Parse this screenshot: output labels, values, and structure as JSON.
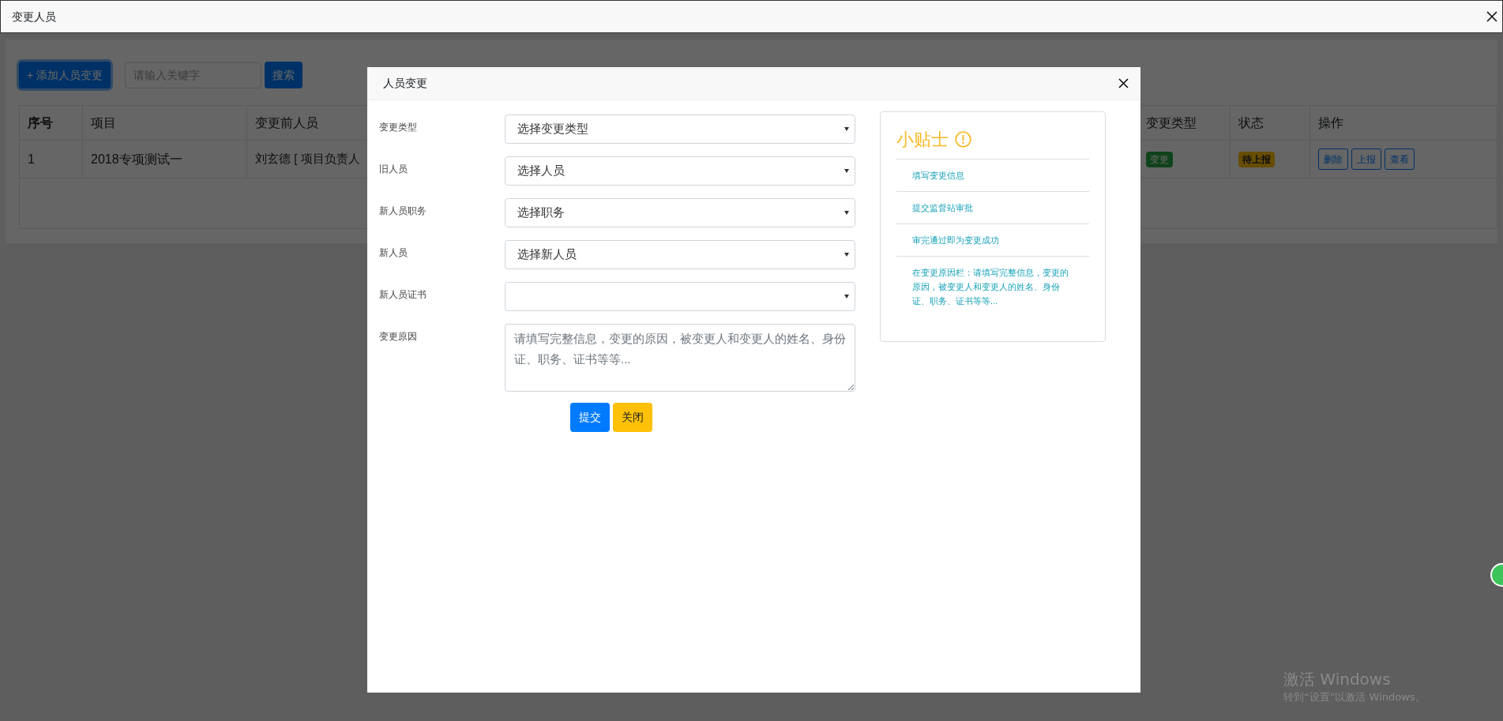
{
  "window": {
    "title": "变更人员"
  },
  "toolbar": {
    "add_button": "+ 添加人员变更",
    "search": {
      "placeholder": "请输入关键字"
    },
    "search_button": "搜索"
  },
  "table": {
    "columns": [
      "序号",
      "项目",
      "变更前人员",
      "变更类型",
      "状态",
      "操作"
    ],
    "rows": [
      {
        "index": "1",
        "project": "2018专项测试一",
        "before_person": "刘玄德 [ 项目负责人",
        "change_type": {
          "text": "变更",
          "kind": "success"
        },
        "status": {
          "text": "待上报",
          "kind": "warning"
        },
        "actions": [
          "删除",
          "上报",
          "查看"
        ]
      }
    ]
  },
  "modal": {
    "title": "人员变更",
    "fields": [
      {
        "label": "变更类型",
        "kind": "select",
        "value": "选择变更类型"
      },
      {
        "label": "旧人员",
        "kind": "select",
        "value": "选择人员"
      },
      {
        "label": "新人员职务",
        "kind": "select",
        "value": "选择职务"
      },
      {
        "label": "新人员",
        "kind": "select",
        "value": "选择新人员"
      },
      {
        "label": "新人员证书",
        "kind": "select"
      },
      {
        "label": "变更原因",
        "kind": "textarea",
        "placeholder": "请填写完整信息，变更的原因，被变更人和变更人的姓名、身份证、职务、证书等等..."
      }
    ],
    "buttons": [
      {
        "label": "提交",
        "kind": "primary"
      },
      {
        "label": "关闭",
        "kind": "warning"
      }
    ],
    "tips": {
      "title": "小贴士",
      "items": [
        "填写变更信息",
        "提交监督站审批",
        "审完通过即为变更成功",
        "在变更原因栏：请填写完整信息，变更的原因，被变更人和变更人的姓名、身份证、职务、证书等等..."
      ]
    }
  },
  "desktop": {
    "activation_title": "激活 Windows",
    "activation_text": "转到“设置”以激活 Windows。"
  }
}
